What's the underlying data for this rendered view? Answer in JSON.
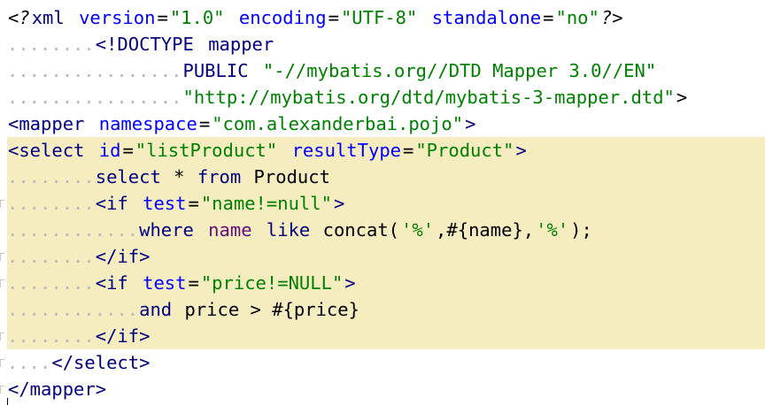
{
  "editor": {
    "background": "#ffffff",
    "highlight_color": "#f5ecc0",
    "lines": [
      {
        "indent": "",
        "parts": [
          {
            "t": "<?",
            "c": "c-bracket c-italic"
          },
          {
            "t": "xml",
            "c": "c-tag"
          },
          {
            "t": " ",
            "c": ""
          },
          {
            "t": "version",
            "c": "c-attr"
          },
          {
            "t": "=",
            "c": "c-plain"
          },
          {
            "t": "\"1.0\"",
            "c": "c-val"
          },
          {
            "t": " ",
            "c": ""
          },
          {
            "t": "encoding",
            "c": "c-attr"
          },
          {
            "t": "=",
            "c": "c-plain"
          },
          {
            "t": "\"UTF-8\"",
            "c": "c-val"
          },
          {
            "t": " ",
            "c": ""
          },
          {
            "t": "standalone",
            "c": "c-attr"
          },
          {
            "t": "=",
            "c": "c-plain"
          },
          {
            "t": "\"no\"",
            "c": "c-val"
          },
          {
            "t": "?>",
            "c": "c-bracket c-italic"
          }
        ]
      },
      {
        "indent": "........",
        "parts": [
          {
            "t": "<!DOCTYPE",
            "c": "c-tag"
          },
          {
            "t": " ",
            "c": ""
          },
          {
            "t": "mapper",
            "c": "c-tag"
          }
        ]
      },
      {
        "indent": "................",
        "parts": [
          {
            "t": "PUBLIC",
            "c": "c-tag"
          },
          {
            "t": " ",
            "c": ""
          },
          {
            "t": "\"-//mybatis.org//DTD Mapper 3.0//EN\"",
            "c": "c-val"
          }
        ]
      },
      {
        "indent": "................",
        "parts": [
          {
            "t": "\"http://mybatis.org/dtd/mybatis-3-mapper.dtd\"",
            "c": "c-val"
          },
          {
            "t": ">",
            "c": "c-bracket"
          }
        ]
      },
      {
        "indent": "",
        "parts": [
          {
            "t": "<mapper",
            "c": "c-tag"
          },
          {
            "t": " ",
            "c": ""
          },
          {
            "t": "namespace",
            "c": "c-attr"
          },
          {
            "t": "=",
            "c": "c-plain"
          },
          {
            "t": "\"com.alexanderbai.pojo\"",
            "c": "c-val"
          },
          {
            "t": ">",
            "c": "c-tag"
          }
        ]
      },
      {
        "indent": "",
        "parts": [
          {
            "t": "<select",
            "c": "c-tag"
          },
          {
            "t": " ",
            "c": ""
          },
          {
            "t": "id",
            "c": "c-attr"
          },
          {
            "t": "=",
            "c": "c-plain"
          },
          {
            "t": "\"listProduct\"",
            "c": "c-val"
          },
          {
            "t": " ",
            "c": ""
          },
          {
            "t": "resultType",
            "c": "c-attr"
          },
          {
            "t": "=",
            "c": "c-plain"
          },
          {
            "t": "\"Product\"",
            "c": "c-val"
          },
          {
            "t": ">",
            "c": "c-tag"
          }
        ]
      },
      {
        "indent": "........",
        "parts": [
          {
            "t": "select",
            "c": "c-sqlkw"
          },
          {
            "t": " * ",
            "c": "c-plain"
          },
          {
            "t": "from",
            "c": "c-sqlkw"
          },
          {
            "t": " Product",
            "c": "c-plain"
          }
        ]
      },
      {
        "indent": "........",
        "parts": [
          {
            "t": "<if",
            "c": "c-tag"
          },
          {
            "t": " ",
            "c": ""
          },
          {
            "t": "test",
            "c": "c-attr"
          },
          {
            "t": "=",
            "c": "c-plain"
          },
          {
            "t": "\"name!=null\"",
            "c": "c-val"
          },
          {
            "t": ">",
            "c": "c-tag"
          }
        ]
      },
      {
        "indent": "............",
        "parts": [
          {
            "t": "where",
            "c": "c-sqlkw"
          },
          {
            "t": " ",
            "c": ""
          },
          {
            "t": "name",
            "c": "c-field"
          },
          {
            "t": " ",
            "c": ""
          },
          {
            "t": "like",
            "c": "c-sqlkw"
          },
          {
            "t": " concat(",
            "c": "c-plain"
          },
          {
            "t": "'%'",
            "c": "c-str"
          },
          {
            "t": ",#{name},",
            "c": "c-plain"
          },
          {
            "t": "'%'",
            "c": "c-str"
          },
          {
            "t": ");",
            "c": "c-plain"
          }
        ]
      },
      {
        "indent": "........",
        "parts": [
          {
            "t": "</if>",
            "c": "c-tag"
          }
        ]
      },
      {
        "indent": "........",
        "parts": [
          {
            "t": "<if",
            "c": "c-tag"
          },
          {
            "t": " ",
            "c": ""
          },
          {
            "t": "test",
            "c": "c-attr"
          },
          {
            "t": "=",
            "c": "c-plain"
          },
          {
            "t": "\"price!=NULL\"",
            "c": "c-val"
          },
          {
            "t": ">",
            "c": "c-tag"
          }
        ]
      },
      {
        "indent": "............",
        "parts": [
          {
            "t": "and",
            "c": "c-sqlkw"
          },
          {
            "t": " price > #{price}",
            "c": "c-plain"
          }
        ]
      },
      {
        "indent": "........",
        "parts": [
          {
            "t": "</if>",
            "c": "c-tag"
          }
        ]
      },
      {
        "indent": "....",
        "parts": [
          {
            "t": "</select>",
            "c": "c-tag"
          }
        ]
      },
      {
        "indent": "",
        "parts": [
          {
            "t": "</mapper>",
            "c": "c-tag"
          }
        ]
      }
    ]
  }
}
